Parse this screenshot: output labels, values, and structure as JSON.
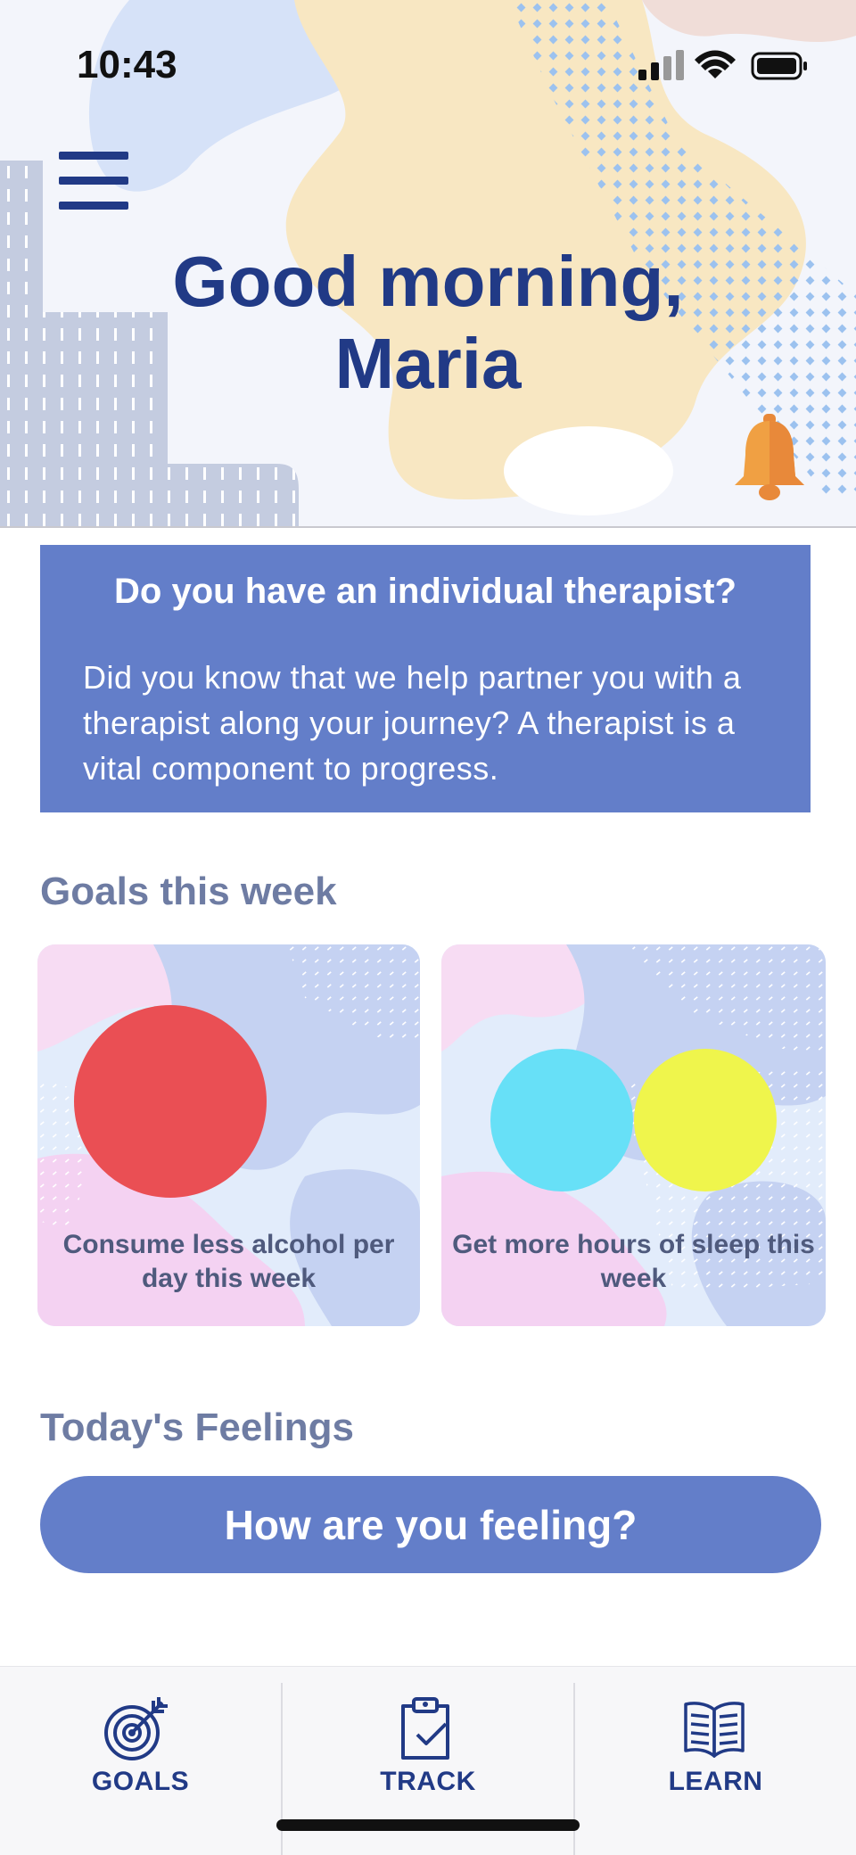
{
  "status_bar": {
    "time": "10:43"
  },
  "header": {
    "greeting_line1": "Good morning,",
    "greeting_line2": "Maria"
  },
  "therapist_card": {
    "title": "Do you have an individual therapist?",
    "body": "Did you know that we help partner you with a therapist along your journey? A therapist is a vital component to progress."
  },
  "goals": {
    "title": "Goals this week",
    "items": [
      {
        "label": "Consume less alcohol per day this week",
        "colors": [
          "#ea4f54"
        ]
      },
      {
        "label": "Get more hours of sleep this week",
        "colors": [
          "#67e0f7",
          "#eff54c"
        ]
      }
    ]
  },
  "feelings": {
    "title": "Today's Feelings",
    "button_label": "How are you feeling?"
  },
  "tabbar": {
    "tabs": [
      {
        "label": "GOALS",
        "icon": "target-icon"
      },
      {
        "label": "TRACK",
        "icon": "clipboard-check-icon"
      },
      {
        "label": "LEARN",
        "icon": "open-book-icon"
      }
    ]
  },
  "colors": {
    "primary": "#213a86",
    "accent": "#637ec9",
    "bell": "#f0a043"
  }
}
